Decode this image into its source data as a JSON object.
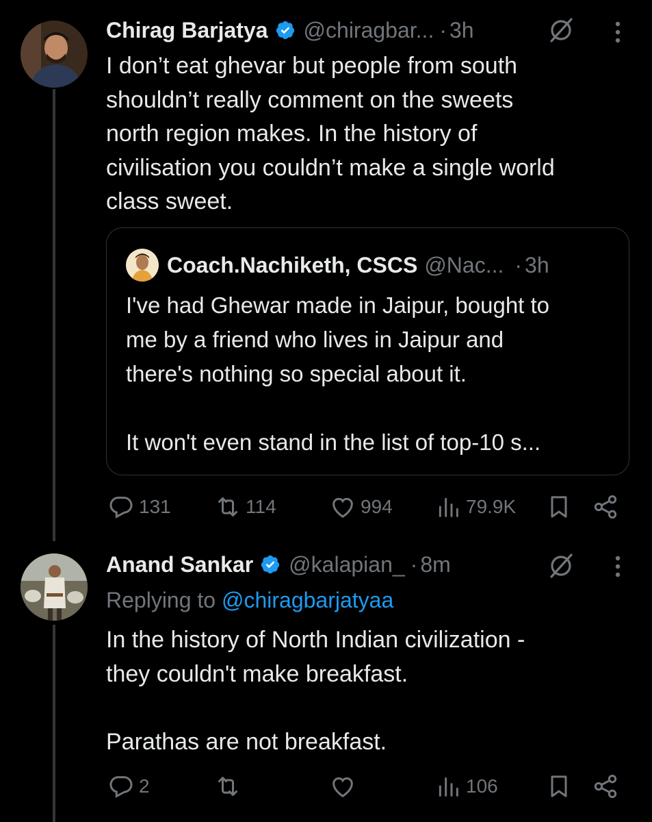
{
  "tweets": [
    {
      "name": "Chirag Barjatya",
      "handle": "@chiragbar...",
      "dot": "·",
      "time": "3h",
      "text_lines": [
        "I don’t eat ghevar but people from south",
        "shouldn’t really comment on the sweets",
        "north region makes. In the history of",
        "civilisation you couldn’t make a single world",
        "class sweet."
      ],
      "quote": {
        "name": "Coach.Nachiketh, CSCS",
        "handle": "@Nac...",
        "dot": "·",
        "time": "3h",
        "text_lines": [
          "I've had Ghewar made in Jaipur, bought to",
          "me by a friend who lives in Jaipur and",
          "there's nothing so special about it.",
          "",
          "It won't even stand in the list of top-10 s..."
        ]
      },
      "actions": {
        "replies": "131",
        "reposts": "114",
        "likes": "994",
        "views": "79.9K"
      }
    },
    {
      "name": "Anand Sankar",
      "handle": "@kalapian_",
      "dot": "·",
      "time": "8m",
      "replying_label": "Replying to ",
      "replying_handle": "@chiragbarjatyaa",
      "text_lines": [
        "In the history of North Indian civilization -",
        "they couldn't make breakfast.",
        "",
        "Parathas are not breakfast."
      ],
      "actions": {
        "replies": "2",
        "reposts": "",
        "likes": "",
        "views": "106"
      }
    }
  ],
  "colors": {
    "text": "#e7e9ea",
    "muted": "#71767b",
    "link": "#1d9bf0",
    "verified": "#1d9bf0",
    "border": "#2f3336"
  },
  "icons": [
    "verified-badge-icon",
    "grok-icon",
    "more-vertical-icon",
    "reply-icon",
    "repost-icon",
    "like-icon",
    "views-icon",
    "bookmark-icon",
    "share-icon"
  ]
}
